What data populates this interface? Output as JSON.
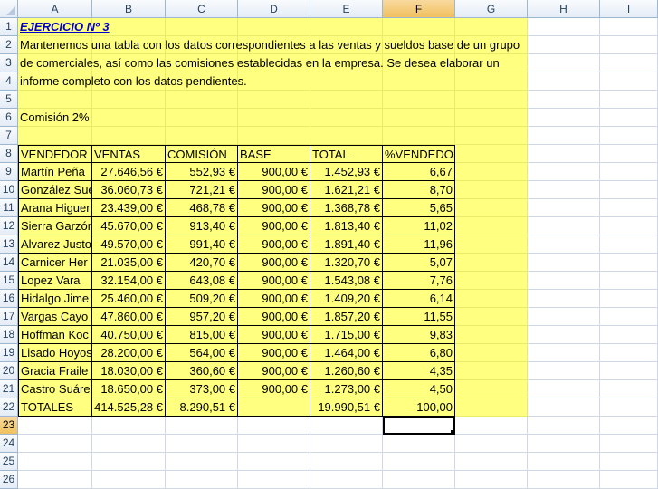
{
  "columns": [
    "A",
    "B",
    "C",
    "D",
    "E",
    "F",
    "G",
    "H",
    "I"
  ],
  "rows": [
    "1",
    "2",
    "3",
    "4",
    "5",
    "6",
    "7",
    "8",
    "9",
    "10",
    "11",
    "12",
    "13",
    "14",
    "15",
    "16",
    "17",
    "18",
    "19",
    "20",
    "21",
    "22",
    "23",
    "24",
    "25",
    "26"
  ],
  "selected_cell": "F23",
  "colors": {
    "highlight": "#ffff80",
    "title": "#0000cc",
    "header": "#e4ecf7",
    "active_header": "#f1c15f"
  },
  "sheet": {
    "title": "EJERCICIO Nº 3",
    "description": [
      "Mantenemos una tabla con los datos correspondientes a las ventas y sueldos base de un grupo",
      "de comerciales, así como las comisiones establecidas en la empresa. Se desea elaborar un",
      "informe completo con los datos pendientes."
    ],
    "commission_label": "Comisión  2%",
    "table": {
      "headers": [
        "VENDEDOR",
        "VENTAS",
        "COMISIÓN",
        "BASE",
        "TOTAL",
        "%VENDEDOR"
      ],
      "rows": [
        [
          "Martín Peña",
          "27.646,56 €",
          "552,93 €",
          "900,00 €",
          "1.452,93 €",
          "6,67"
        ],
        [
          "González Sue",
          "36.060,73 €",
          "721,21 €",
          "900,00 €",
          "1.621,21 €",
          "8,70"
        ],
        [
          "Arana Higuer",
          "23.439,00 €",
          "468,78 €",
          "900,00 €",
          "1.368,78 €",
          "5,65"
        ],
        [
          "Sierra Garzón",
          "45.670,00 €",
          "913,40 €",
          "900,00 €",
          "1.813,40 €",
          "11,02"
        ],
        [
          "Alvarez Justo",
          "49.570,00 €",
          "991,40 €",
          "900,00 €",
          "1.891,40 €",
          "11,96"
        ],
        [
          "Carnicer Her",
          "21.035,00 €",
          "420,70 €",
          "900,00 €",
          "1.320,70 €",
          "5,07"
        ],
        [
          "Lopez Vara",
          "32.154,00 €",
          "643,08 €",
          "900,00 €",
          "1.543,08 €",
          "7,76"
        ],
        [
          "Hidalgo Jime",
          "25.460,00 €",
          "509,20 €",
          "900,00 €",
          "1.409,20 €",
          "6,14"
        ],
        [
          "Vargas Cayo",
          "47.860,00 €",
          "957,20 €",
          "900,00 €",
          "1.857,20 €",
          "11,55"
        ],
        [
          "Hoffman Koc",
          "40.750,00 €",
          "815,00 €",
          "900,00 €",
          "1.715,00 €",
          "9,83"
        ],
        [
          "Lisado Hoyos",
          "28.200,00 €",
          "564,00 €",
          "900,00 €",
          "1.464,00 €",
          "6,80"
        ],
        [
          "Gracia Fraile",
          "18.030,00 €",
          "360,60 €",
          "900,00 €",
          "1.260,60 €",
          "4,35"
        ],
        [
          "Castro Suáre",
          "18.650,00 €",
          "373,00 €",
          "900,00 €",
          "1.273,00 €",
          "4,50"
        ]
      ],
      "totals": [
        "TOTALES",
        "414.525,28 €",
        "8.290,51 €",
        "",
        "19.990,51 €",
        "100,00"
      ]
    }
  }
}
